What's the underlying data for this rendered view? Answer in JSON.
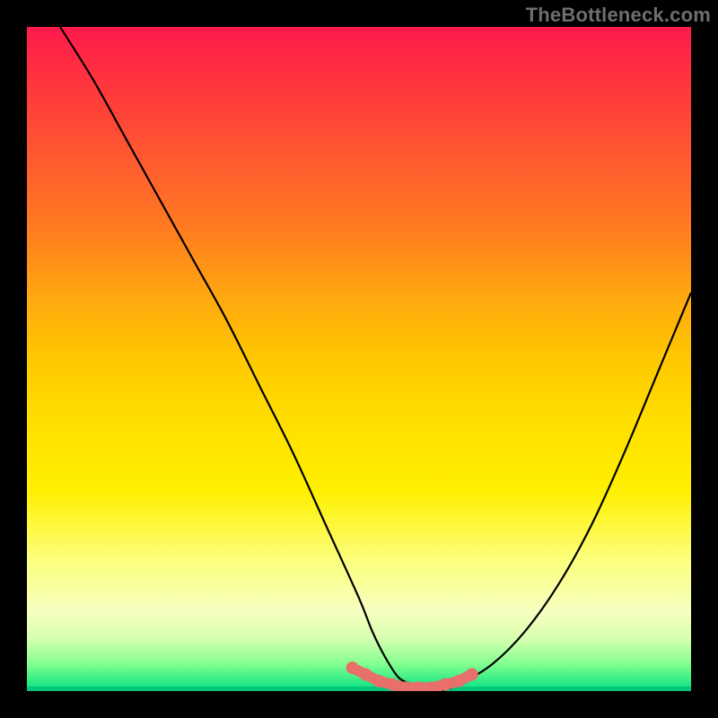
{
  "watermark": "TheBottleneck.com",
  "chart_data": {
    "type": "line",
    "title": "",
    "xlabel": "",
    "ylabel": "",
    "xlim": [
      0,
      100
    ],
    "ylim": [
      0,
      100
    ],
    "grid": false,
    "legend": false,
    "background_gradient": {
      "top": "#ff1a4d",
      "middle": "#ffe000",
      "bottom": "#00e080"
    },
    "series": [
      {
        "name": "bottleneck_curve",
        "color": "#000000",
        "x": [
          5,
          10,
          15,
          20,
          25,
          30,
          35,
          40,
          45,
          50,
          52,
          54,
          56,
          58,
          60,
          62,
          65,
          70,
          75,
          80,
          85,
          90,
          95,
          100
        ],
        "values": [
          100,
          92,
          83,
          74,
          65,
          56,
          46,
          36,
          25,
          14,
          9,
          5,
          2,
          1,
          0,
          0,
          1,
          4,
          9,
          16,
          25,
          36,
          48,
          60
        ]
      }
    ],
    "highlight": {
      "name": "optimal_zone",
      "color": "#e86f6a",
      "x": [
        49,
        51,
        53,
        55,
        57,
        59,
        61,
        63,
        65,
        67
      ],
      "values": [
        3.5,
        2.5,
        1.5,
        1,
        0.5,
        0.5,
        0.5,
        1,
        1.5,
        2.5
      ]
    }
  }
}
